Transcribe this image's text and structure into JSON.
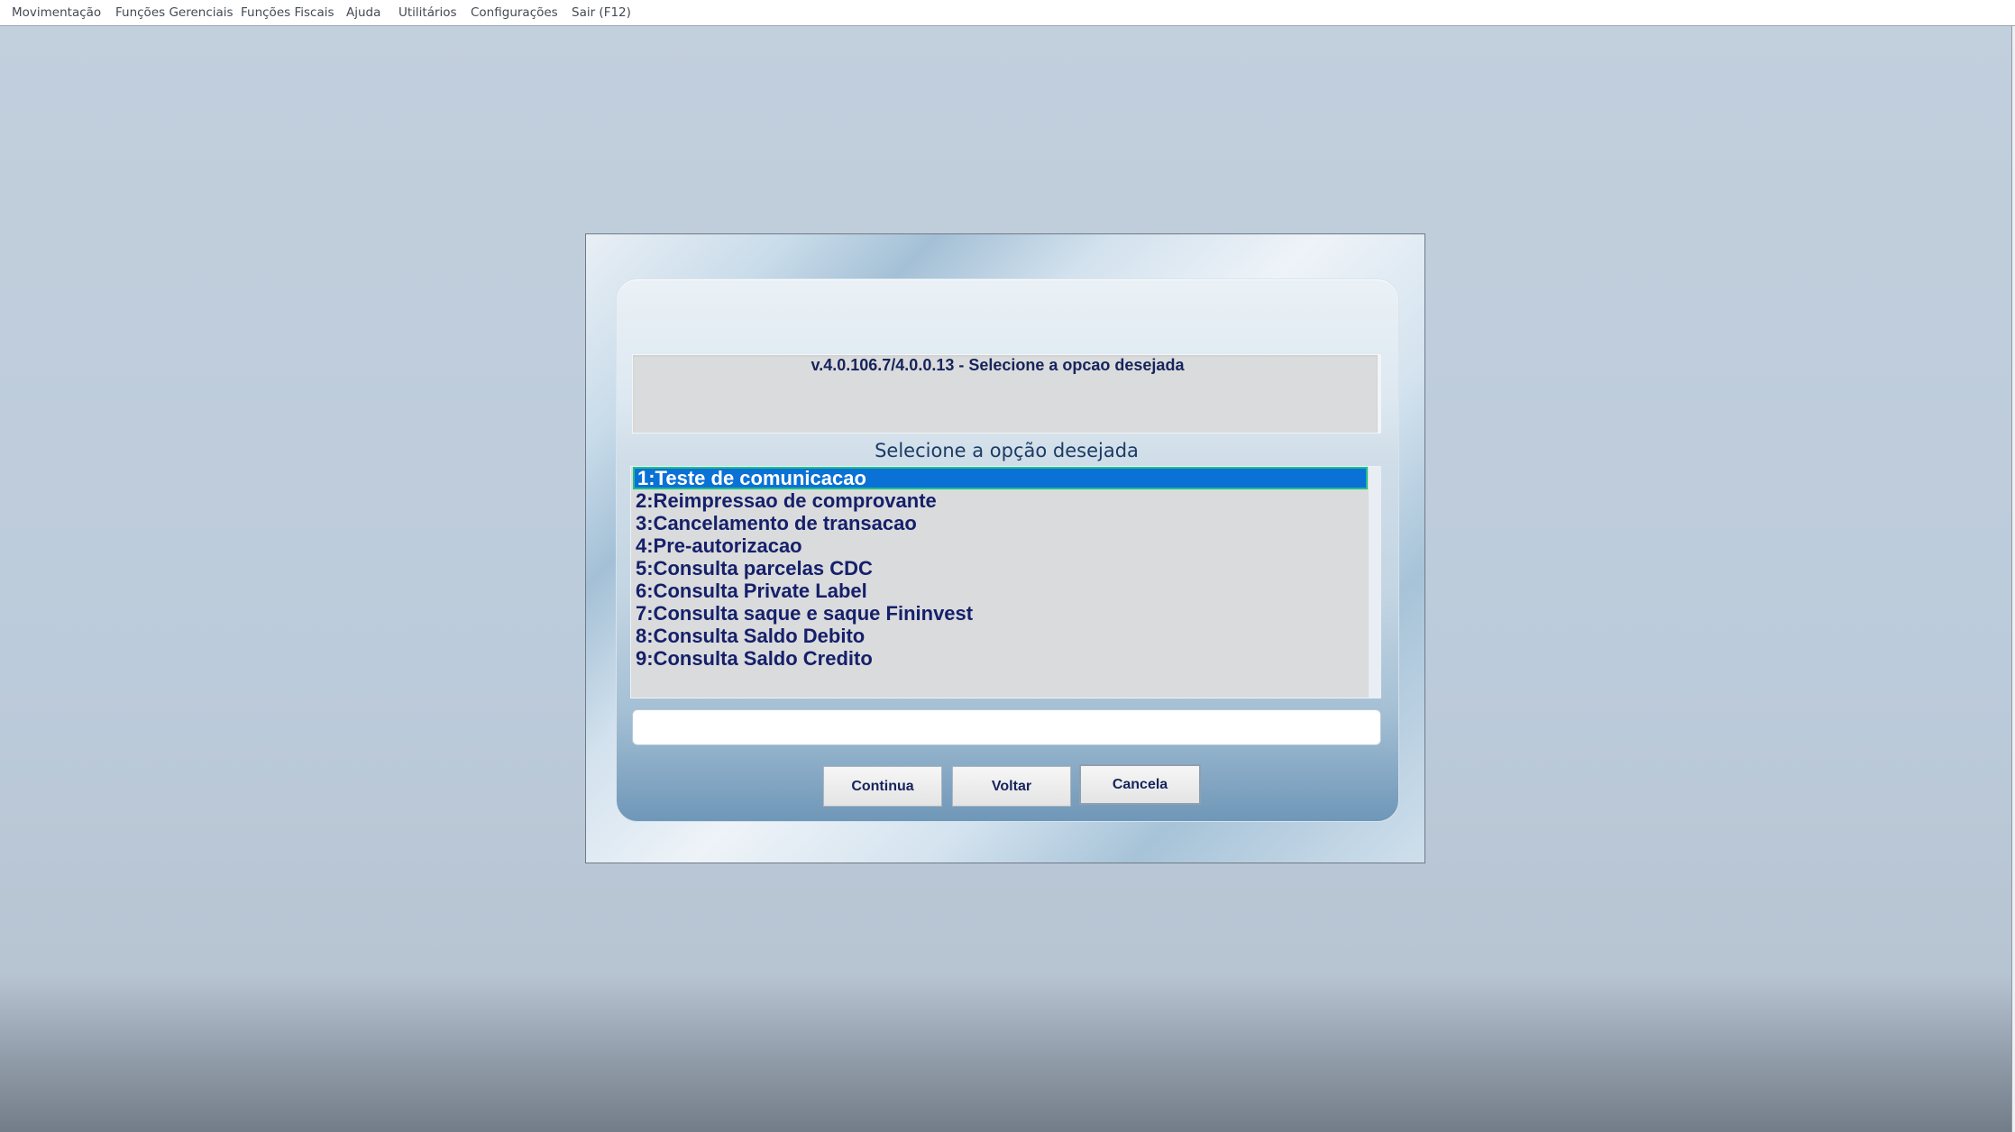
{
  "menubar": {
    "items": [
      {
        "label": "Movimentação"
      },
      {
        "label": "Funções Gerenciais"
      },
      {
        "label": "Funções Fiscais"
      },
      {
        "label": "Ajuda"
      },
      {
        "label": "Utilitários"
      },
      {
        "label": "Configurações"
      },
      {
        "label": "Sair (F12)"
      }
    ]
  },
  "dialog": {
    "header": "v.4.0.106.7/4.0.0.13 - Selecione a opcao desejada",
    "list_title": "Selecione a opção desejada",
    "options": [
      {
        "label": "1:Teste de comunicacao",
        "selected": true
      },
      {
        "label": "2:Reimpressao de comprovante",
        "selected": false
      },
      {
        "label": "3:Cancelamento de transacao",
        "selected": false
      },
      {
        "label": "4:Pre-autorizacao",
        "selected": false
      },
      {
        "label": "5:Consulta parcelas CDC",
        "selected": false
      },
      {
        "label": "6:Consulta Private Label",
        "selected": false
      },
      {
        "label": "7:Consulta saque e saque Fininvest",
        "selected": false
      },
      {
        "label": "8:Consulta Saldo Debito",
        "selected": false
      },
      {
        "label": "9:Consulta Saldo Credito",
        "selected": false
      }
    ],
    "input_value": "",
    "buttons": {
      "continua": "Continua",
      "voltar": "Voltar",
      "cancela": "Cancela"
    }
  },
  "colors": {
    "selection": "#0a71d6",
    "selection_border": "#1fc08a",
    "item_text": "#15206a",
    "desktop_background": "#bccbdb"
  }
}
